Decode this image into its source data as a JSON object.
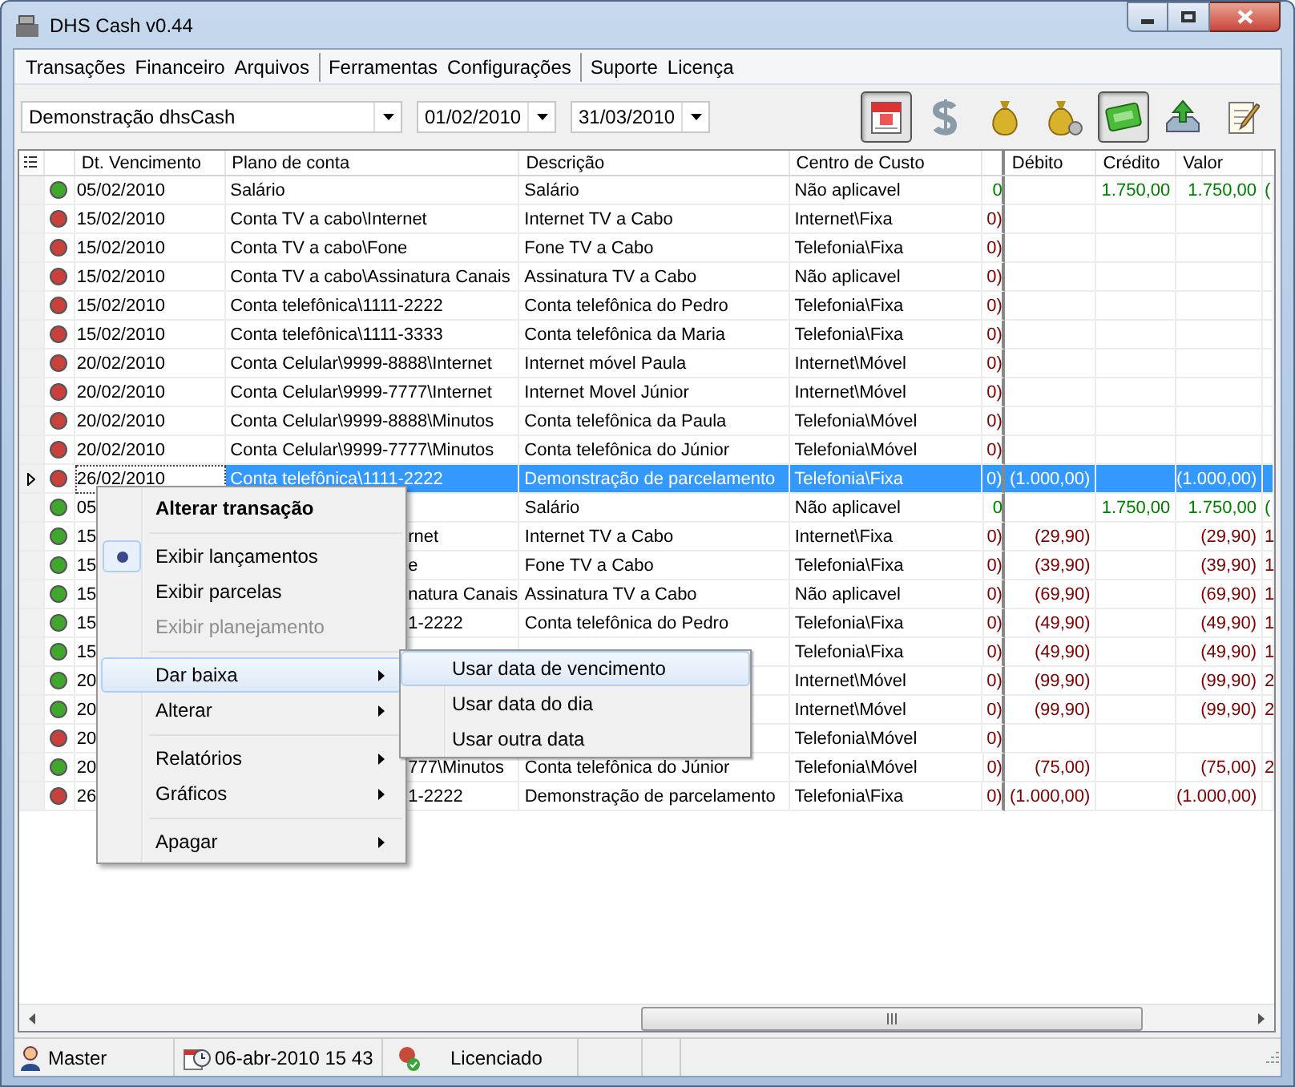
{
  "window": {
    "title": "DHS Cash v0.44"
  },
  "menubar": [
    [
      "Transações",
      "Financeiro",
      "Arquivos"
    ],
    [
      "Ferramentas",
      "Configurações"
    ],
    [
      "Suporte",
      "Licença"
    ]
  ],
  "filters": {
    "account": "Demonstração dhsCash",
    "start_date": "01/02/2010",
    "end_date": "31/03/2010"
  },
  "toolbar": [
    {
      "kind": "calendar",
      "selected": true
    },
    {
      "kind": "dollar",
      "selected": false
    },
    {
      "kind": "bag",
      "selected": false
    },
    {
      "kind": "bag-coins",
      "selected": false
    },
    {
      "kind": "ticket",
      "selected": true
    },
    {
      "kind": "upload",
      "selected": false
    },
    {
      "kind": "notepad",
      "selected": false
    }
  ],
  "table": {
    "columns": [
      "Dt. Vencimento",
      "Plano de conta",
      "Descrição",
      "Centro de Custo",
      "Débito",
      "Crédito",
      "Valor"
    ],
    "rows": [
      {
        "color": "#3fa82c",
        "date": "05/02/2010",
        "plan": "Salário",
        "description": "Salário",
        "cost_center": "Não aplicavel",
        "column_6": "0",
        "credit": "1.750,00",
        "value": "1.750,00",
        "column_10": "(",
        "kind": "credit",
        "selected": false
      },
      {
        "color": "#c9413a",
        "date": "15/02/2010",
        "plan": "Conta TV a cabo\\Internet",
        "description": "Internet TV a Cabo",
        "cost_center": "Internet\\Fixa",
        "column_6": "0)",
        "kind": "debit",
        "selected": false
      },
      {
        "color": "#c9413a",
        "date": "15/02/2010",
        "plan": "Conta TV a cabo\\Fone",
        "description": "Fone TV a Cabo",
        "cost_center": "Telefonia\\Fixa",
        "column_6": "0)",
        "kind": "debit",
        "selected": false
      },
      {
        "color": "#c9413a",
        "date": "15/02/2010",
        "plan": "Conta TV a cabo\\Assinatura Canais",
        "description": "Assinatura TV a Cabo",
        "cost_center": "Não aplicavel",
        "column_6": "0)",
        "kind": "debit",
        "selected": false
      },
      {
        "color": "#c9413a",
        "date": "15/02/2010",
        "plan": "Conta telefônica\\1111-2222",
        "description": "Conta telefônica do Pedro",
        "cost_center": "Telefonia\\Fixa",
        "column_6": "0)",
        "kind": "debit",
        "selected": false
      },
      {
        "color": "#c9413a",
        "date": "15/02/2010",
        "plan": "Conta telefônica\\1111-3333",
        "description": "Conta telefônica da Maria",
        "cost_center": "Telefonia\\Fixa",
        "column_6": "0)",
        "kind": "debit",
        "selected": false
      },
      {
        "color": "#c9413a",
        "date": "20/02/2010",
        "plan": "Conta Celular\\9999-8888\\Internet",
        "description": "Internet móvel Paula",
        "cost_center": "Internet\\Móvel",
        "column_6": "0)",
        "kind": "debit",
        "selected": false
      },
      {
        "color": "#c9413a",
        "date": "20/02/2010",
        "plan": "Conta Celular\\9999-7777\\Internet",
        "description": "Internet Movel Júnior",
        "cost_center": "Internet\\Móvel",
        "column_6": "0)",
        "kind": "debit",
        "selected": false
      },
      {
        "color": "#c9413a",
        "date": "20/02/2010",
        "plan": "Conta Celular\\9999-8888\\Minutos",
        "description": "Conta telefônica da Paula",
        "cost_center": "Telefonia\\Móvel",
        "column_6": "0)",
        "kind": "debit",
        "selected": false
      },
      {
        "color": "#c9413a",
        "date": "20/02/2010",
        "plan": "Conta Celular\\9999-7777\\Minutos",
        "description": "Conta telefônica do Júnior",
        "cost_center": "Telefonia\\Móvel",
        "column_6": "0)",
        "kind": "debit",
        "selected": false
      },
      {
        "color": "#c9413a",
        "date": "26/02/2010",
        "plan": "Conta telefônica\\1111-2222",
        "description": "Demonstração de parcelamento",
        "cost_center": "Telefonia\\Fixa",
        "column_6": "0)",
        "debit": "(1.000,00)",
        "value": "(1.000,00)",
        "kind": "debit",
        "selected": true
      },
      {
        "color": "#3fa82c",
        "date": "05",
        "description": "Salário",
        "cost_center": "Não aplicavel",
        "column_6": "0",
        "credit": "1.750,00",
        "value": "1.750,00",
        "column_10": "(",
        "kind": "credit",
        "selected": false
      },
      {
        "color": "#3fa82c",
        "date": "15",
        "plan": "rnet",
        "description": "Internet TV a Cabo",
        "cost_center": "Internet\\Fixa",
        "column_6": "0)",
        "debit": "(29,90)",
        "value": "(29,90)",
        "column_10": "1",
        "kind": "debit",
        "selected": false
      },
      {
        "color": "#3fa82c",
        "date": "15",
        "plan": "e",
        "description": "Fone TV a Cabo",
        "cost_center": "Telefonia\\Fixa",
        "column_6": "0)",
        "debit": "(39,90)",
        "value": "(39,90)",
        "column_10": "1",
        "kind": "debit",
        "selected": false
      },
      {
        "color": "#3fa82c",
        "date": "15",
        "plan": "natura Canais",
        "description": "Assinatura TV a Cabo",
        "cost_center": "Não aplicavel",
        "column_6": "0)",
        "debit": "(69,90)",
        "value": "(69,90)",
        "column_10": "1",
        "kind": "debit",
        "selected": false
      },
      {
        "color": "#3fa82c",
        "date": "15",
        "plan": "1-2222",
        "description": "Conta telefônica do Pedro",
        "cost_center": "Telefonia\\Fixa",
        "column_6": "0)",
        "debit": "(49,90)",
        "value": "(49,90)",
        "column_10": "1",
        "kind": "debit",
        "selected": false
      },
      {
        "color": "#3fa82c",
        "date": "15",
        "cost_center": "Telefonia\\Fixa",
        "column_6": "0)",
        "debit": "(49,90)",
        "value": "(49,90)",
        "column_10": "1",
        "kind": "debit",
        "selected": false
      },
      {
        "color": "#3fa82c",
        "date": "20",
        "cost_center": "Internet\\Móvel",
        "column_6": "0)",
        "debit": "(99,90)",
        "value": "(99,90)",
        "column_10": "2",
        "kind": "debit",
        "selected": false
      },
      {
        "color": "#3fa82c",
        "date": "20",
        "cost_center": "Internet\\Móvel",
        "column_6": "0)",
        "debit": "(99,90)",
        "value": "(99,90)",
        "column_10": "2",
        "kind": "debit",
        "selected": false
      },
      {
        "color": "#c9413a",
        "date": "20",
        "cost_center": "Telefonia\\Móvel",
        "column_6": "0)",
        "kind": "debit",
        "selected": false
      },
      {
        "color": "#3fa82c",
        "date": "20",
        "plan": "777\\Minutos",
        "description": "Conta telefônica do Júnior",
        "cost_center": "Telefonia\\Móvel",
        "column_6": "0)",
        "debit": "(75,00)",
        "value": "(75,00)",
        "column_10": "2",
        "kind": "debit",
        "selected": false
      },
      {
        "color": "#c9413a",
        "date": "26",
        "plan": "1-2222",
        "description": "Demonstração de parcelamento",
        "cost_center": "Telefonia\\Fixa",
        "column_6": "0)",
        "debit": "(1.000,00)",
        "value": "(1.000,00)",
        "kind": "debit",
        "selected": false
      }
    ]
  },
  "context_menu": [
    {
      "kind": "default",
      "label": "Alterar transação",
      "checked": false,
      "disabled": false,
      "submenu": false,
      "selected": false
    },
    {
      "kind": "separator"
    },
    {
      "kind": "item",
      "label": "Exibir lançamentos",
      "checked": true,
      "disabled": false,
      "submenu": false,
      "selected": false
    },
    {
      "kind": "item",
      "label": "Exibir parcelas",
      "checked": false,
      "disabled": false,
      "submenu": false,
      "selected": false
    },
    {
      "kind": "item",
      "label": "Exibir planejamento",
      "checked": false,
      "disabled": true,
      "submenu": false,
      "selected": false
    },
    {
      "kind": "separator"
    },
    {
      "kind": "item",
      "label": "Dar baixa",
      "checked": false,
      "disabled": false,
      "submenu": true,
      "selected": true
    },
    {
      "kind": "item",
      "label": "Alterar",
      "checked": false,
      "disabled": false,
      "submenu": true,
      "selected": false
    },
    {
      "kind": "separator"
    },
    {
      "kind": "item",
      "label": "Relatórios",
      "checked": false,
      "disabled": false,
      "submenu": true,
      "selected": false
    },
    {
      "kind": "item",
      "label": "Gráficos",
      "checked": false,
      "disabled": false,
      "submenu": true,
      "selected": false
    },
    {
      "kind": "separator"
    },
    {
      "kind": "item",
      "label": "Apagar",
      "checked": false,
      "disabled": false,
      "submenu": true,
      "selected": false
    }
  ],
  "submenu": [
    {
      "label": "Usar data de vencimento",
      "selected": true
    },
    {
      "label": "Usar data do dia",
      "selected": false
    },
    {
      "label": "Usar outra data",
      "selected": false
    }
  ],
  "status_bar": {
    "user": "Master",
    "datetime": "06-abr-2010 15 43",
    "license": "Licenciado"
  }
}
